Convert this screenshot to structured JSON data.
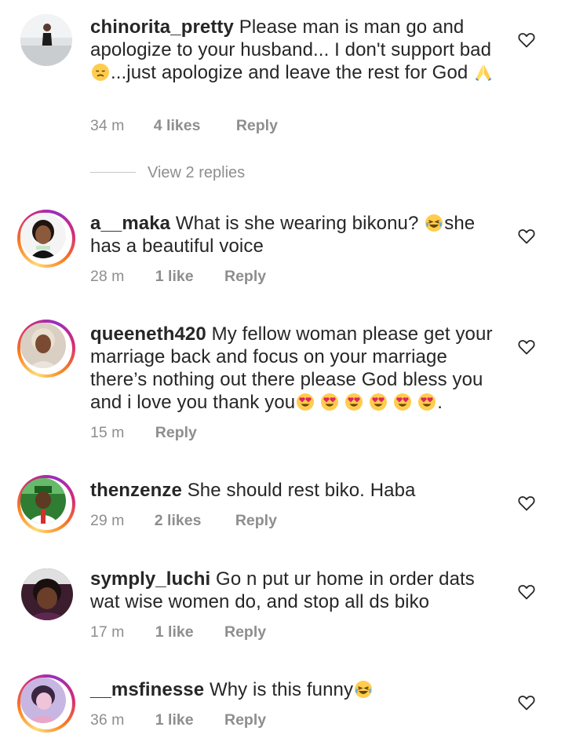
{
  "comments": [
    {
      "username": "chinorita_pretty",
      "text_parts": [
        "Please man is man go and apologize to your husband... I don't support bad ",
        "...just apologize and leave the rest for God "
      ],
      "emojis": [
        "disappointed-face-emoji",
        "folded-hands-emoji"
      ],
      "time": "34 m",
      "likes": "4 likes",
      "reply": "Reply",
      "view_replies": "View 2 replies"
    },
    {
      "username": "a__maka",
      "text_parts": [
        "What is she wearing bikonu? ",
        "she has a beautiful voice"
      ],
      "emojis": [
        "tears-of-joy-emoji"
      ],
      "time": "28 m",
      "likes": "1 like",
      "reply": "Reply"
    },
    {
      "username": "queeneth420",
      "text_parts": [
        "My fellow woman please get your marriage back and focus on your marriage there’s nothing out there please God bless you and i love you thank you",
        "."
      ],
      "emojis": [
        "heart-eyes-emoji",
        "heart-eyes-emoji",
        "heart-eyes-emoji",
        "heart-eyes-emoji",
        "heart-eyes-emoji",
        "heart-eyes-emoji"
      ],
      "time": "15 m",
      "reply": "Reply"
    },
    {
      "username": "thenzenze",
      "text_parts": [
        "She should rest biko. Haba"
      ],
      "time": "29 m",
      "likes": "2 likes",
      "reply": "Reply"
    },
    {
      "username": "symply_luchi",
      "text_parts": [
        "Go n put ur home in order dats wat wise women do, and stop all ds biko"
      ],
      "time": "17 m",
      "likes": "1 like",
      "reply": "Reply"
    },
    {
      "username": "__msfinesse",
      "text_parts": [
        "Why is this funny"
      ],
      "emojis": [
        "tears-of-joy-emoji"
      ],
      "time": "36 m",
      "likes": "1 like",
      "reply": "Reply"
    }
  ],
  "icons": {
    "like": "heart-outline-icon"
  },
  "colors": {
    "text": "#262626",
    "meta": "#8e8e8e",
    "ring_start": "#feda75",
    "ring_mid": "#d62976",
    "ring_end": "#962fbf"
  }
}
